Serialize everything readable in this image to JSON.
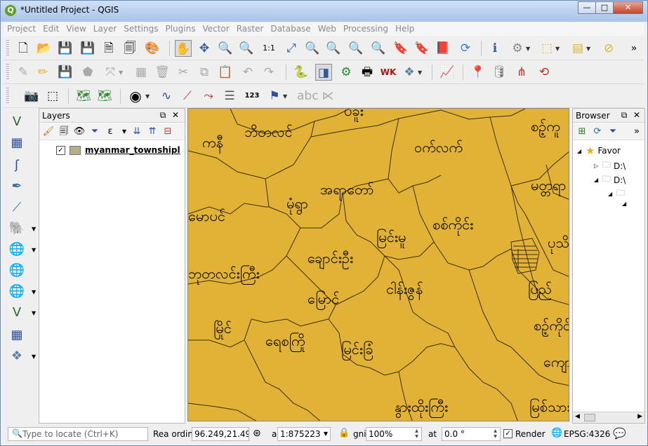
{
  "window": {
    "title": "*Untitled Project - QGIS",
    "app_icon": "Q",
    "buttons": {
      "minimize": "—",
      "maximize": "□",
      "close": "✕"
    }
  },
  "menu": [
    "Project",
    "Edit",
    "View",
    "Layer",
    "Settings",
    "Plugins",
    "Vector",
    "Raster",
    "Database",
    "Web",
    "Processing",
    "Help"
  ],
  "toolbar_more": "»",
  "layers_panel": {
    "title": "Layers",
    "layer": {
      "name": "myanmar_townshipl",
      "checked": "✓",
      "swatch_color": "#b5b08a"
    }
  },
  "browser_panel": {
    "title": "Browser",
    "items": [
      {
        "label": "Favor"
      },
      {
        "label": "D:\\"
      },
      {
        "label": "D:\\"
      }
    ]
  },
  "map": {
    "fill_color": "#e1b235",
    "labels": [
      "ပဲခူး",
      "ဘိတလင်",
      "ကနီ",
      "ဝက်လက်",
      "စဉ့်ကူ",
      "အရာတော်",
      "မုံရွာ",
      "မတ္တရာ",
      "မောပင်",
      "မြင်းမူ",
      "စစ်ကိုင်း",
      "ပုသိမ်",
      "ချောင်းဦး",
      "ဘုတလင်းကြီး",
      "မြောင်",
      "ငါန်းဇွန်",
      "ပြည်",
      "မြိုင်",
      "ရေစကြို",
      "မြင်းခြံ",
      "စဉ့်ကိုင်",
      "ကျောက်",
      "နွားထိုးကြီး",
      "မြစ်သား"
    ]
  },
  "statusbar": {
    "locate_placeholder": "Type to locate (Ctrl+K)",
    "coord_label": "Rea ordin",
    "coordinate": "96.249,21.494",
    "scale_label": "a",
    "scale": "1:875223",
    "magnifier_label": "gni",
    "magnifier": "100%",
    "rotation_label": "at",
    "rotation": "0.0 °",
    "render_checked": "✓",
    "render_label": "Render",
    "crs": "EPSG:4326"
  }
}
